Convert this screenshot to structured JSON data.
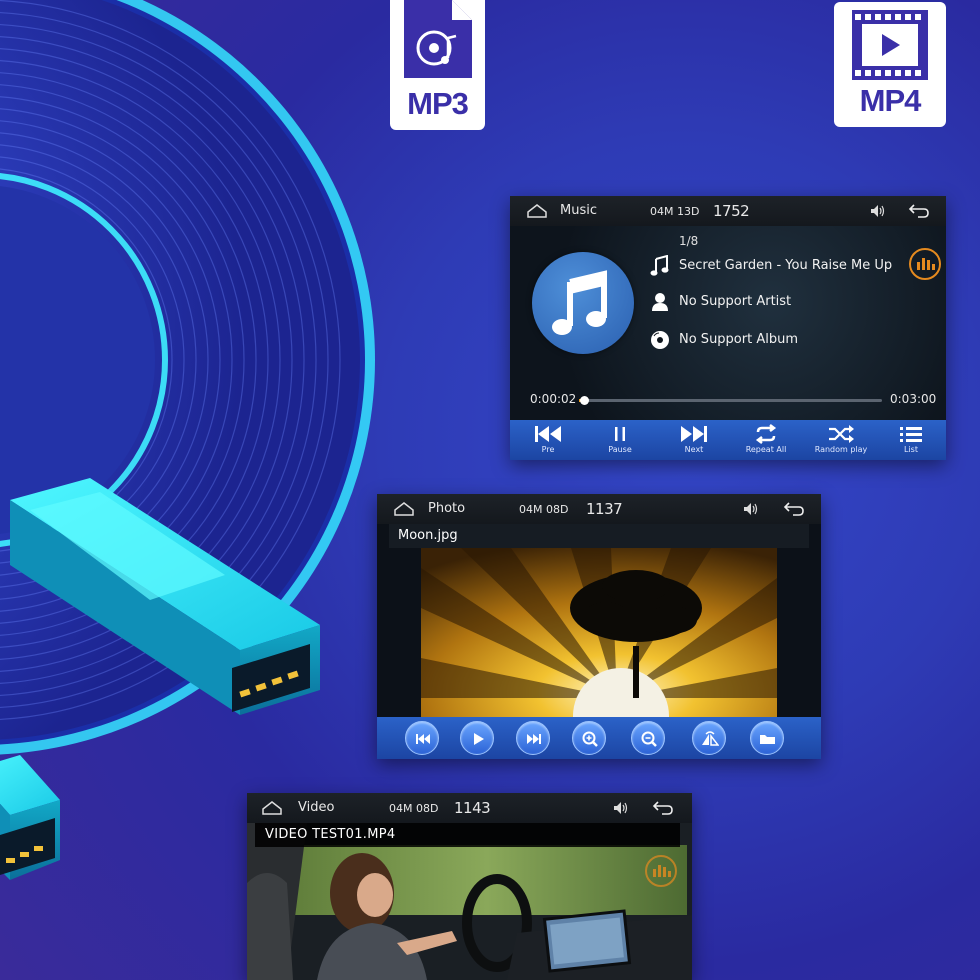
{
  "formats": {
    "mp3": {
      "label": "MP3",
      "icon": "music-disc-file-icon"
    },
    "mp4": {
      "label": "MP4",
      "icon": "video-file-icon"
    }
  },
  "music_panel": {
    "app_title": "Music",
    "date": "04M 13D",
    "time": "1752",
    "track_counter": "1/8",
    "title": "Secret Garden - You Raise Me Up",
    "artist": "No Support Artist",
    "album": "No Support Album",
    "elapsed": "0:00:02",
    "duration": "0:03:00",
    "progress": 0.011,
    "controls": [
      {
        "label": "Pre",
        "icon": "previous-icon"
      },
      {
        "label": "Pause",
        "icon": "pause-icon"
      },
      {
        "label": "Next",
        "icon": "next-icon"
      },
      {
        "label": "Repeat All",
        "icon": "repeat-icon"
      },
      {
        "label": "Random play",
        "icon": "shuffle-icon"
      },
      {
        "label": "List",
        "icon": "list-icon"
      }
    ]
  },
  "photo_panel": {
    "app_title": "Photo",
    "date": "04M 08D",
    "time": "1137",
    "filename": "Moon.jpg",
    "controls": [
      "previous-icon",
      "play-icon",
      "next-icon",
      "zoom-in-icon",
      "zoom-out-icon",
      "rotate-icon",
      "folder-icon"
    ]
  },
  "video_panel": {
    "app_title": "Video",
    "date": "04M 08D",
    "time": "1143",
    "filename": "VIDEO TEST01.MP4"
  }
}
